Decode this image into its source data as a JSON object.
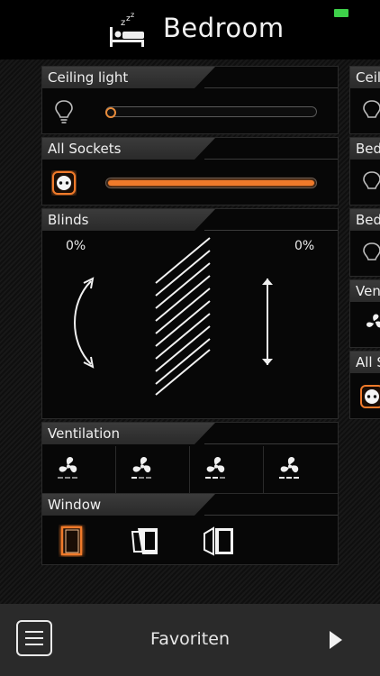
{
  "header": {
    "title": "Bedroom",
    "icon": "sleeping-bed-icon",
    "battery_color": "#3ed14a"
  },
  "cards": {
    "ceiling_light": {
      "label": "Ceiling light",
      "level_fraction": 0.0
    },
    "all_sockets": {
      "label": "All Sockets",
      "level_fraction": 1.0
    },
    "blinds": {
      "label": "Blinds",
      "tilt_percent": "0%",
      "position_percent": "0%"
    },
    "ventilation": {
      "label": "Ventilation",
      "levels": [
        "fan-off",
        "fan-level-1",
        "fan-level-2",
        "fan-level-3"
      ]
    },
    "window": {
      "label": "Window",
      "states": [
        "closed",
        "tilted",
        "open"
      ],
      "active": "closed"
    }
  },
  "side_cards": [
    "Ceili",
    "Bed",
    "Bed",
    "Ven",
    "All S"
  ],
  "footer": {
    "title": "Favoriten"
  },
  "accent": "#f07a2a"
}
